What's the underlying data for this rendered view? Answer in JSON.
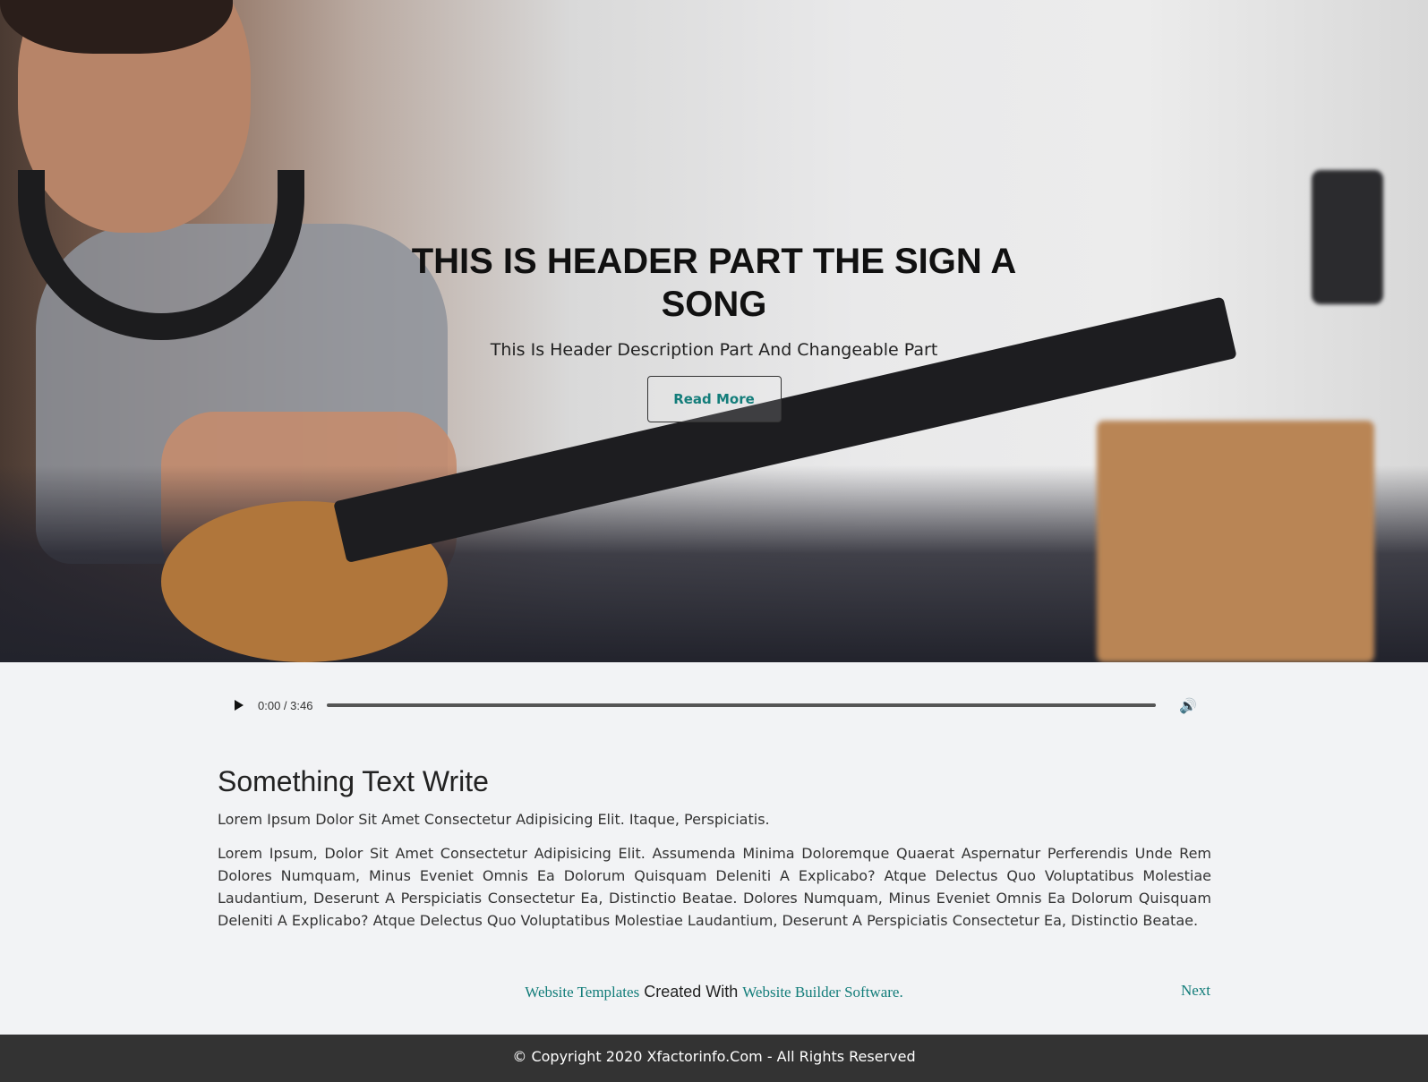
{
  "hero": {
    "title": "THIS IS HEADER PART THE SIGN A SONG",
    "description": "This Is Header Description Part And Changeable Part",
    "button": "Read More"
  },
  "audio": {
    "time": "0:00 / 3:46",
    "progress": 0,
    "play_icon": "play-icon",
    "volume_icon": "volume-icon"
  },
  "content": {
    "heading": "Something Text Write",
    "intro": "Lorem Ipsum Dolor Sit Amet Consectetur Adipisicing Elit. Itaque, Perspiciatis.",
    "body": "Lorem Ipsum, Dolor Sit Amet Consectetur Adipisicing Elit. Assumenda Minima Doloremque Quaerat Aspernatur Perferendis Unde Rem Dolores Numquam, Minus Eveniet Omnis Ea Dolorum Quisquam Deleniti A Explicabo? Atque Delectus Quo Voluptatibus Molestiae Laudantium, Deserunt A Perspiciatis Consectetur Ea, Distinctio Beatae. Dolores Numquam, Minus Eveniet Omnis Ea Dolorum Quisquam Deleniti A Explicabo? Atque Delectus Quo Voluptatibus Molestiae Laudantium, Deserunt A Perspiciatis Consectetur Ea, Distinctio Beatae."
  },
  "credit": {
    "link1": "Website Templates",
    "middle": " Created With ",
    "link2": "Website Builder Software.",
    "next": "Next"
  },
  "footer": {
    "copyright": "© Copyright 2020 Xfactorinfo.Com - All Rights Reserved"
  },
  "colors": {
    "accent": "#137d7a",
    "footer_bg": "#333333",
    "page_bg": "#f2f3f5"
  }
}
